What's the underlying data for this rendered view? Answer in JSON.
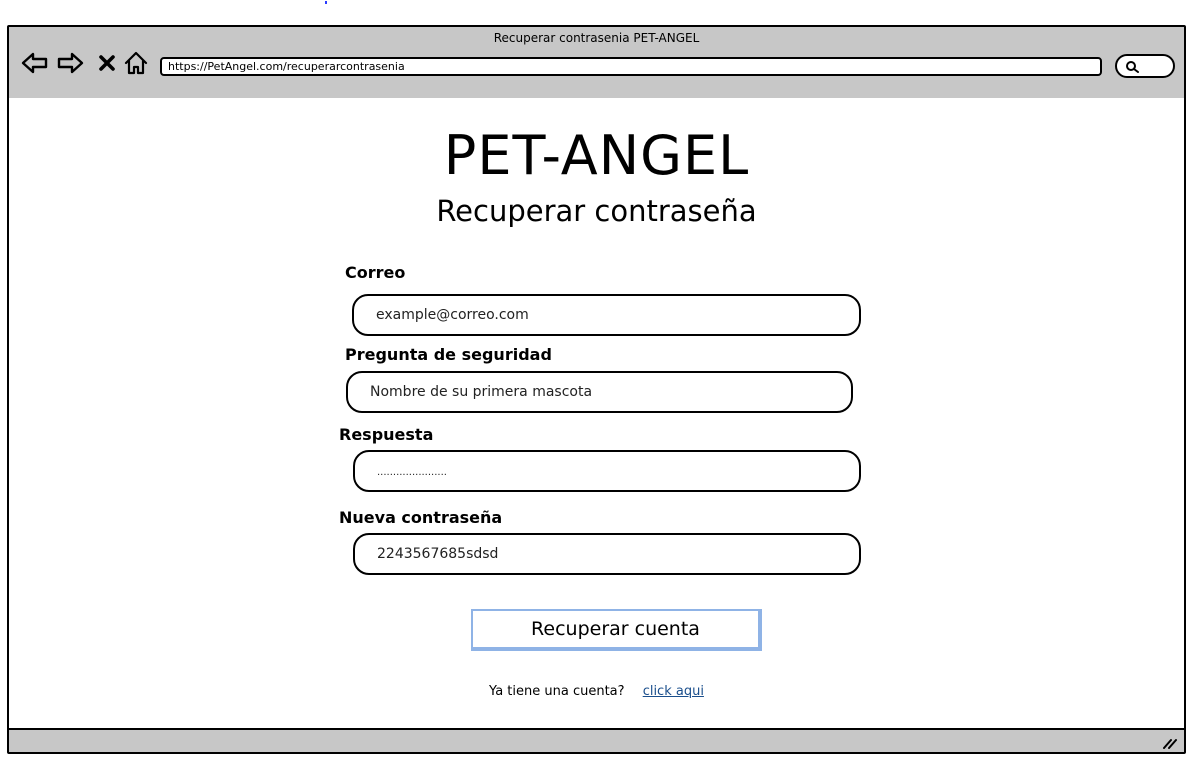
{
  "window": {
    "title": "Recuperar contrasenia PET-ANGEL",
    "url": "https://PetAngel.com/recuperarcontrasenia"
  },
  "page": {
    "brand": "PET-ANGEL",
    "subtitle": "Recuperar contraseña"
  },
  "form": {
    "email": {
      "label": "Correo",
      "value": "example@correo.com"
    },
    "security_question": {
      "label": "Pregunta de seguridad",
      "value": "Nombre de su primera mascota"
    },
    "answer": {
      "label": "Respuesta",
      "value": "......................"
    },
    "new_password": {
      "label": "Nueva contraseña",
      "value": "2243567685sdsd"
    },
    "submit_label": "Recuperar cuenta"
  },
  "footer": {
    "prompt": "Ya tiene una cuenta?",
    "link_text": "click aqui"
  },
  "icons": {
    "back": "back-arrow-icon",
    "forward": "forward-arrow-icon",
    "stop": "close-icon",
    "home": "home-icon",
    "search": "search-icon",
    "resize": "resize-grip-icon"
  },
  "colors": {
    "chrome": "#c7c7c7",
    "button_border": "#8fb3e6",
    "link": "#1a4e8c"
  }
}
